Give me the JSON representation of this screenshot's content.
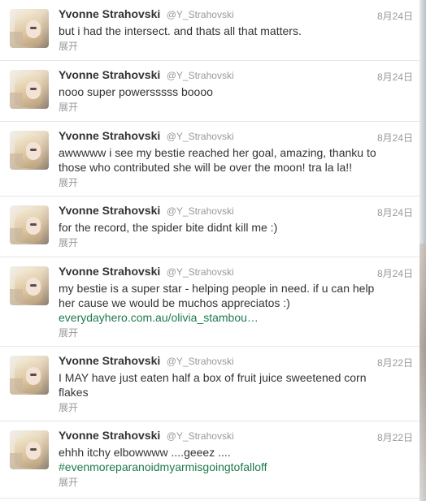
{
  "tweets": [
    {
      "name": "Yvonne Strahovski",
      "handle": "@Y_Strahovski",
      "time": "8月24日",
      "text": "but i had the intersect. and thats all that matters.",
      "link": "",
      "expand": "展开"
    },
    {
      "name": "Yvonne Strahovski",
      "handle": "@Y_Strahovski",
      "time": "8月24日",
      "text": "nooo super powersssss boooo",
      "link": "",
      "expand": "展开"
    },
    {
      "name": "Yvonne Strahovski",
      "handle": "@Y_Strahovski",
      "time": "8月24日",
      "text": "awwwww i see my bestie reached her goal, amazing, thanku to those who contributed she will be over the moon! tra la la!!",
      "link": "",
      "expand": "展开"
    },
    {
      "name": "Yvonne Strahovski",
      "handle": "@Y_Strahovski",
      "time": "8月24日",
      "text": "for the record, the spider bite didnt kill me :)",
      "link": "",
      "expand": "展开"
    },
    {
      "name": "Yvonne Strahovski",
      "handle": "@Y_Strahovski",
      "time": "8月24日",
      "text": "my bestie is a super star - helping people in need. if u can help her cause we would be muchos appreciatos :)",
      "link": "everydayhero.com.au/olivia_stambou…",
      "expand": "展开"
    },
    {
      "name": "Yvonne Strahovski",
      "handle": "@Y_Strahovski",
      "time": "8月22日",
      "text": "I MAY have just eaten half a box of fruit juice sweetened corn flakes",
      "link": "",
      "expand": "展开"
    },
    {
      "name": "Yvonne Strahovski",
      "handle": "@Y_Strahovski",
      "time": "8月22日",
      "text": "ehhh itchy elbowwww ....geeez ....",
      "link": "#evenmoreparanoidmyarmisgoingtofalloff",
      "expand": "展开"
    }
  ],
  "colors": {
    "link": "#1f7a4a",
    "meta": "#999999",
    "text": "#333333"
  }
}
